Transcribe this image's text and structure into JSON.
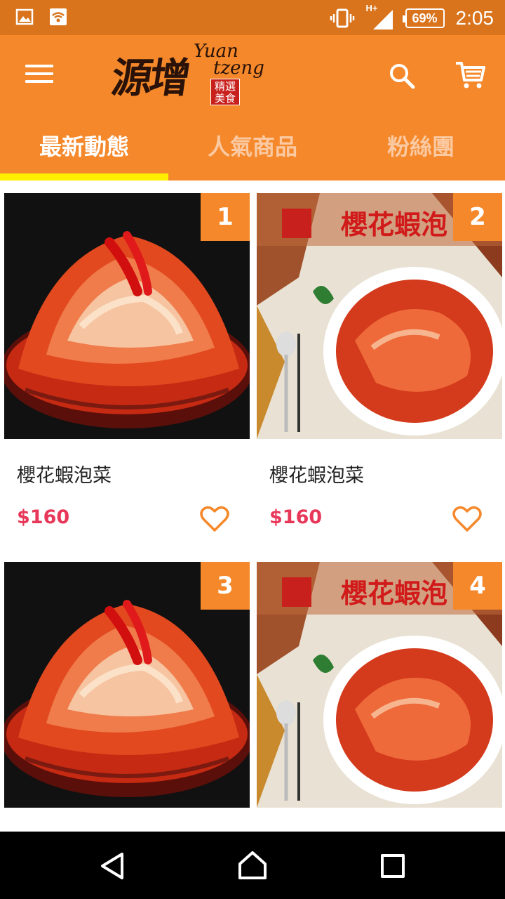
{
  "status_bar": {
    "battery": "69%",
    "time": "2:05",
    "network": "H+"
  },
  "app": {
    "logo_cn": "源增",
    "logo_en_line1": "Yuan",
    "logo_en_line2": "tzeng",
    "logo_stamp": "精選美食"
  },
  "tabs": [
    {
      "label": "最新動態",
      "active": true
    },
    {
      "label": "人氣商品",
      "active": false
    },
    {
      "label": "粉絲團",
      "active": false
    }
  ],
  "products": [
    {
      "rank": "1",
      "name": "櫻花蝦泡菜",
      "price": "$160",
      "image": "kimchi-bowl"
    },
    {
      "rank": "2",
      "name": "櫻花蝦泡菜",
      "price": "$160",
      "image": "kimchi-plate-banner"
    },
    {
      "rank": "3",
      "name": "",
      "price": "",
      "image": "kimchi-bowl"
    },
    {
      "rank": "4",
      "name": "",
      "price": "",
      "image": "kimchi-plate-banner"
    }
  ],
  "colors": {
    "statusbar": "#d9731c",
    "appbar": "#f4882a",
    "indicator": "#ffee00",
    "price": "#e8385a",
    "heart": "#f4882a"
  }
}
